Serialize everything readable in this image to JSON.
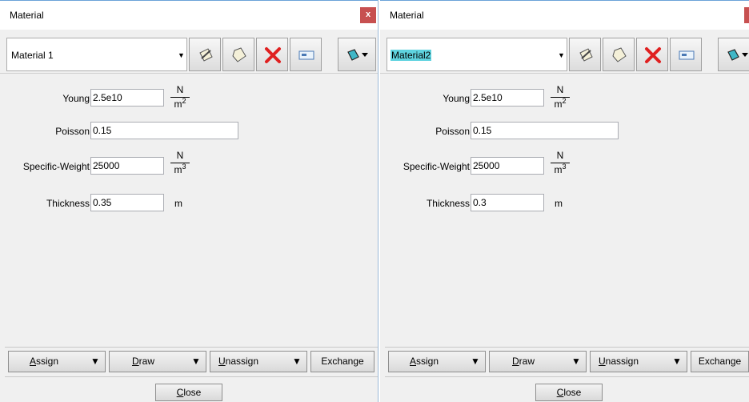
{
  "left": {
    "title": "Material",
    "close_glyph": "x",
    "material_name": "Material 1",
    "fields": {
      "young_label": "Young",
      "young_value": "2.5e10",
      "poisson_label": "Poisson",
      "poisson_value": "0.15",
      "weight_label": "Specific-Weight",
      "weight_value": "25000",
      "thickness_label": "Thickness",
      "thickness_value": "0.35"
    },
    "units": {
      "young_num": "N",
      "young_den": "m",
      "young_exp": "2",
      "weight_num": "N",
      "weight_den": "m",
      "weight_exp": "3",
      "thickness": "m"
    },
    "buttons": {
      "assign_u": "A",
      "assign_rest": "ssign",
      "draw_u": "D",
      "draw_rest": "raw",
      "unassign_u": "U",
      "unassign_rest": "nassign",
      "exchange": "Exchange"
    },
    "close_u": "C",
    "close_rest": "lose"
  },
  "right": {
    "title": "Material",
    "close_glyph": "x",
    "material_name": "Material2",
    "fields": {
      "young_label": "Young",
      "young_value": "2.5e10",
      "poisson_label": "Poisson",
      "poisson_value": "0.15",
      "weight_label": "Specific-Weight",
      "weight_value": "25000",
      "thickness_label": "Thickness",
      "thickness_value": "0.3"
    },
    "units": {
      "young_num": "N",
      "young_den": "m",
      "young_exp": "2",
      "weight_num": "N",
      "weight_den": "m",
      "weight_exp": "3",
      "thickness": "m"
    },
    "buttons": {
      "assign_u": "A",
      "assign_rest": "ssign",
      "draw_u": "D",
      "draw_rest": "raw",
      "unassign_u": "U",
      "unassign_rest": "nassign",
      "exchange": "Exchange"
    },
    "close_u": "C",
    "close_rest": "lose"
  },
  "icons": [
    "edit-material-icon",
    "new-material-icon",
    "delete-icon",
    "rename-icon",
    "export-dropdown-icon"
  ],
  "colors": {
    "close_red": "#c75050",
    "selection_cyan": "#5fd3df",
    "delete_red": "#e02020"
  }
}
